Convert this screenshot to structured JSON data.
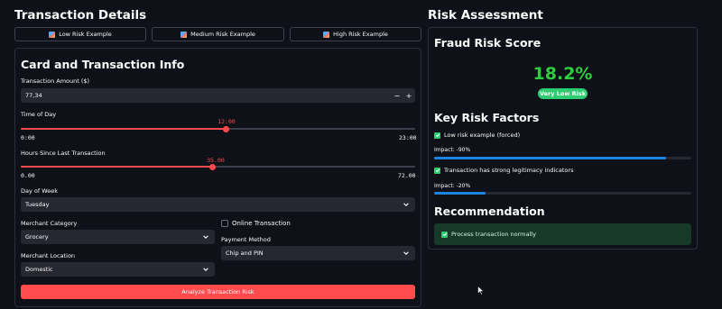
{
  "left": {
    "title": "Transaction Details",
    "examples": [
      {
        "label": "Low Risk Example"
      },
      {
        "label": "Medium Risk Example"
      },
      {
        "label": "High Risk Example"
      }
    ],
    "form": {
      "title": "Card and Transaction Info",
      "amount": {
        "label": "Transaction Amount ($)",
        "value": "77,34",
        "minus": "−",
        "plus": "+"
      },
      "time_of_day": {
        "label": "Time of Day",
        "value": "12:00",
        "min": "0:00",
        "max": "23:00",
        "fraction": 0.52
      },
      "hours_since": {
        "label": "Hours Since Last Transaction",
        "value": "35.00",
        "min": "0.00",
        "max": "72.00",
        "fraction": 0.4861
      },
      "day_of_week": {
        "label": "Day of Week",
        "value": "Tuesday"
      },
      "merchant_category": {
        "label": "Merchant Category",
        "value": "Grocery"
      },
      "online": {
        "label": "Online Transaction",
        "checked": false
      },
      "payment_method": {
        "label": "Payment Method",
        "value": "Chip and PIN"
      },
      "merchant_location": {
        "label": "Merchant Location",
        "value": "Domestic"
      },
      "submit": {
        "label": "Analyze Transaction Risk"
      }
    }
  },
  "right": {
    "title": "Risk Assessment",
    "score_title": "Fraud Risk Score",
    "score": "18.2%",
    "badge": "Very Low Risk",
    "factors_title": "Key Risk Factors",
    "factors": [
      {
        "label": "Low risk example (forced)",
        "impact": "Impact: -90%",
        "fraction": 0.9
      },
      {
        "label": "Transaction has strong legitimacy indicators",
        "impact": "Impact: -20%",
        "fraction": 0.2
      }
    ],
    "recommendation_title": "Recommendation",
    "recommendation": "Process transaction normally"
  },
  "colors": {
    "accent": "#ff4b4b",
    "score": "#2ecc40",
    "badge": "#2ecc71",
    "impact_bar": "#1c83e1",
    "recommend_bg": "#173928"
  }
}
